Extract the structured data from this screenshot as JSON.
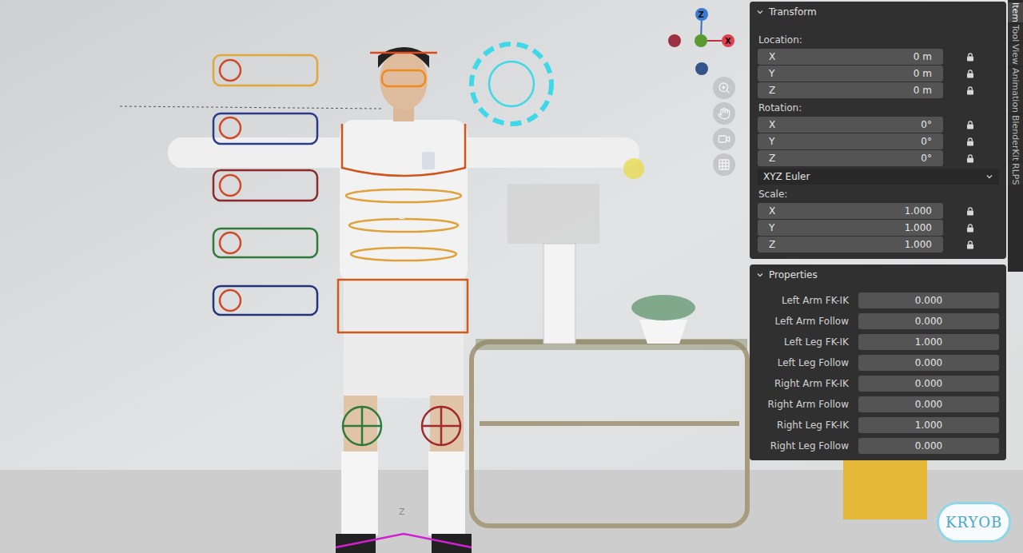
{
  "viewport": {
    "labels": [
      "Z",
      "Z"
    ],
    "watermark": "KRYOB"
  },
  "gizmo": {
    "z": "Z",
    "x": "X"
  },
  "sidebar_tabs": [
    {
      "label": "Item",
      "selected": true
    },
    {
      "label": "Tool",
      "selected": false
    },
    {
      "label": "View",
      "selected": false
    },
    {
      "label": "Animation",
      "selected": false
    },
    {
      "label": "BlenderKit",
      "selected": false
    },
    {
      "label": "RLPS",
      "selected": false
    }
  ],
  "transform": {
    "title": "Transform",
    "location": {
      "label": "Location:",
      "fields": [
        {
          "axis": "X",
          "value": "0 m"
        },
        {
          "axis": "Y",
          "value": "0 m"
        },
        {
          "axis": "Z",
          "value": "0 m"
        }
      ]
    },
    "rotation": {
      "label": "Rotation:",
      "fields": [
        {
          "axis": "X",
          "value": "0°"
        },
        {
          "axis": "Y",
          "value": "0°"
        },
        {
          "axis": "Z",
          "value": "0°"
        }
      ]
    },
    "rotation_mode": "XYZ Euler",
    "scale": {
      "label": "Scale:",
      "fields": [
        {
          "axis": "X",
          "value": "1.000"
        },
        {
          "axis": "Y",
          "value": "1.000"
        },
        {
          "axis": "Z",
          "value": "1.000"
        }
      ]
    }
  },
  "properties": {
    "title": "Properties",
    "rows": [
      {
        "label": "Left Arm FK-IK",
        "value": "0.000"
      },
      {
        "label": "Left Arm Follow",
        "value": "0.000"
      },
      {
        "label": "Left Leg FK-IK",
        "value": "1.000"
      },
      {
        "label": "Left Leg Follow",
        "value": "0.000"
      },
      {
        "label": "Right Arm FK-IK",
        "value": "0.000"
      },
      {
        "label": "Right Arm Follow",
        "value": "0.000"
      },
      {
        "label": "Right Leg FK-IK",
        "value": "1.000"
      },
      {
        "label": "Right Leg Follow",
        "value": "0.000"
      }
    ]
  }
}
